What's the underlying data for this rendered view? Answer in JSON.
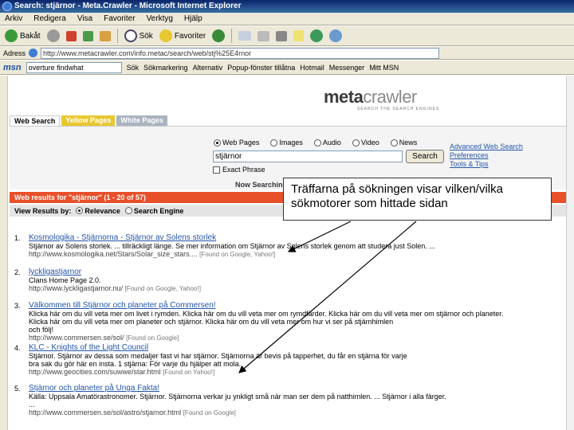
{
  "window": {
    "title": "Search: stjärnor - Meta.Crawler - Microsoft Internet Explorer"
  },
  "menu": [
    "Arkiv",
    "Redigera",
    "Visa",
    "Favoriter",
    "Verktyg",
    "Hjälp"
  ],
  "toolbar": {
    "back": "Bakåt",
    "search": "Sök",
    "favorites": "Favoriter"
  },
  "address": {
    "label": "Adress",
    "url": "http://www.metacrawler.com/info.metac/search/web/stj%25E4rnor"
  },
  "msn": {
    "logo": "msn",
    "search_value": "overture findwhat",
    "search": "Sök",
    "bookmark": "Sökmarkering",
    "alternatives": "Alternativ",
    "popup": "Popup-fönster tillåtna",
    "hotmail": "Hotmail",
    "messenger": "Messenger",
    "mymsn": "Mitt MSN"
  },
  "logo": {
    "meta": "meta",
    "crawler": "crawler",
    "tagline": "SEARCH THE SEARCH ENGINES"
  },
  "tabs": {
    "web": "Web Search",
    "yellow": "Yellow Pages",
    "white": "White Pages"
  },
  "search": {
    "options": [
      "Web Pages",
      "Images",
      "Audio",
      "Video",
      "News"
    ],
    "query": "stjärnor",
    "button": "Search",
    "exact": "Exact Phrase",
    "links": [
      "Advanced Web Search",
      "Preferences",
      "Tools & Tips"
    ],
    "now": "Now Searching"
  },
  "results_header": "Web results for \"stjärnor\" (1 - 20 of 57)",
  "view": {
    "label": "View Results by:",
    "relevance": "Relevance",
    "engine": "Search Engine"
  },
  "results": [
    {
      "num": "1.",
      "title": "Kosmologika - Stjärnorna - Stjärnor av Solens storlek",
      "desc": "Stjärnor av Solens storlek. ... tillräckligt länge. Se mer information om Stjärnor av Solens storlek genom att studera just Solen. ...",
      "url": "http://www.kosmologika.net/Stars/Solar_size_stars....",
      "src": "[Found on Google, Yahoo!]"
    },
    {
      "num": "2.",
      "title": "lyckligastjarnor",
      "desc": "Clans Home Page 2.0.",
      "url": "http://www.lyckligastjarnor.nu/",
      "src": "[Found on Google, Yahoo!]"
    },
    {
      "num": "3.",
      "title": "Välkommen till Stjärnor och planeter på Commersen!",
      "desc": "Klicka här om du vill veta mer om livet i rymden. Klicka här om du vill veta mer om rymdfärder. Klicka här om du vill veta mer om stjärnor och planeter.",
      "desc2": "Klicka här om du vill veta mer om planeter och stjärnor. Klicka här om du vill veta mer om hur vi ser på stjärnhimlen",
      "desc3": "och följ!",
      "url": "http://www.commersen.se/sol/",
      "src": "[Found on Google]"
    },
    {
      "num": "4.",
      "title": "KLC - Knights of the Light Council",
      "desc": "Stjärnor. Stjärnor av dessa som medaljer fast vi har stjärnor. Stjärnorna är bevis på tapperhet, du får en stjärna för varje",
      "desc2": "bra sak du gör här en insta. 1 stjärna: För varje du hjälper att mola.",
      "url": "http://www.geocities.com/suwwe/star.html",
      "src": "[Found on Yahoo!]"
    },
    {
      "num": "5.",
      "title": "Stjärnor och planeter på Unga Fakta!",
      "desc": "Källa: Uppsala Amatörastronomer. Stjärnor. Stjärnorna verkar ju ynkligt små när man ser dem på natthimlen. ... Stjärnor i alla färger.",
      "desc2": "...",
      "url": "http://www.commersen.se/sol/astro/stjarnor.html",
      "src": "[Found on Google]"
    }
  ],
  "annotation": "Träffarna på sökningen visar vilken/vilka sökmotorer som hittade sidan",
  "colors": {
    "orange": "#e8502a",
    "link": "#2255aa",
    "yellow_tab": "#e8c830"
  }
}
